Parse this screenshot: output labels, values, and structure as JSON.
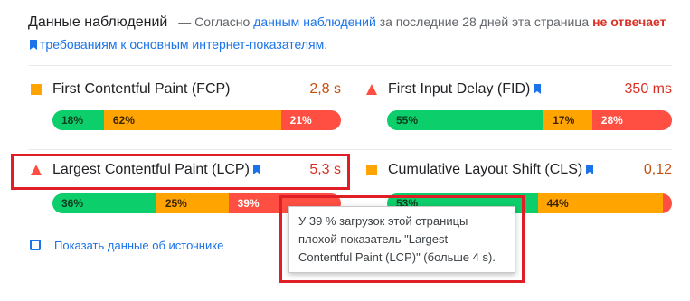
{
  "header": {
    "title": "Данные наблюдений",
    "dash": "—",
    "text_1": "Согласно",
    "link_1": "данным наблюдений",
    "text_2": "за последние 28 дней эта страница",
    "status": "не отвечает",
    "link_2": "требованиям к основным интернет-показателям",
    "end": "."
  },
  "metrics": {
    "fcp": {
      "name": "First Contentful Paint (FCP)",
      "value": "2,8 s",
      "status_icon": "orange-square-icon",
      "distribution": [
        {
          "label": "18%",
          "fraction": 0.18
        },
        {
          "label": "62%",
          "fraction": 0.62
        },
        {
          "label": "21%",
          "fraction": 0.21
        }
      ]
    },
    "fid": {
      "name": "First Input Delay (FID)",
      "value": "350 ms",
      "status_icon": "red-triangle-icon",
      "distribution": [
        {
          "label": "55%",
          "fraction": 0.55
        },
        {
          "label": "17%",
          "fraction": 0.17
        },
        {
          "label": "28%",
          "fraction": 0.28
        }
      ]
    },
    "lcp": {
      "name": "Largest Contentful Paint (LCP)",
      "value": "5,3 s",
      "status_icon": "red-triangle-icon",
      "distribution": [
        {
          "label": "36%",
          "fraction": 0.36
        },
        {
          "label": "25%",
          "fraction": 0.25
        },
        {
          "label": "39%",
          "fraction": 0.39
        }
      ]
    },
    "cls": {
      "name": "Cumulative Layout Shift (CLS)",
      "value": "0,12",
      "status_icon": "orange-square-icon",
      "distribution": [
        {
          "label": "53%",
          "fraction": 0.53
        },
        {
          "label": "44%",
          "fraction": 0.44
        },
        {
          "label": "3%",
          "fraction": 0.03
        }
      ]
    }
  },
  "source_toggle": {
    "label": "Показать данные об источнике"
  },
  "tooltip": {
    "line_1": "У 39 % загрузок этой страницы",
    "line_2": "плохой показатель \"Largest",
    "line_3": "Contentful Paint (LCP)\" (больше 4 s)."
  },
  "colors": {
    "good": "#0cce6b",
    "average": "#ffa400",
    "poor": "#ff4e42",
    "link": "#1a73e8",
    "highlight": "#e01e26"
  }
}
